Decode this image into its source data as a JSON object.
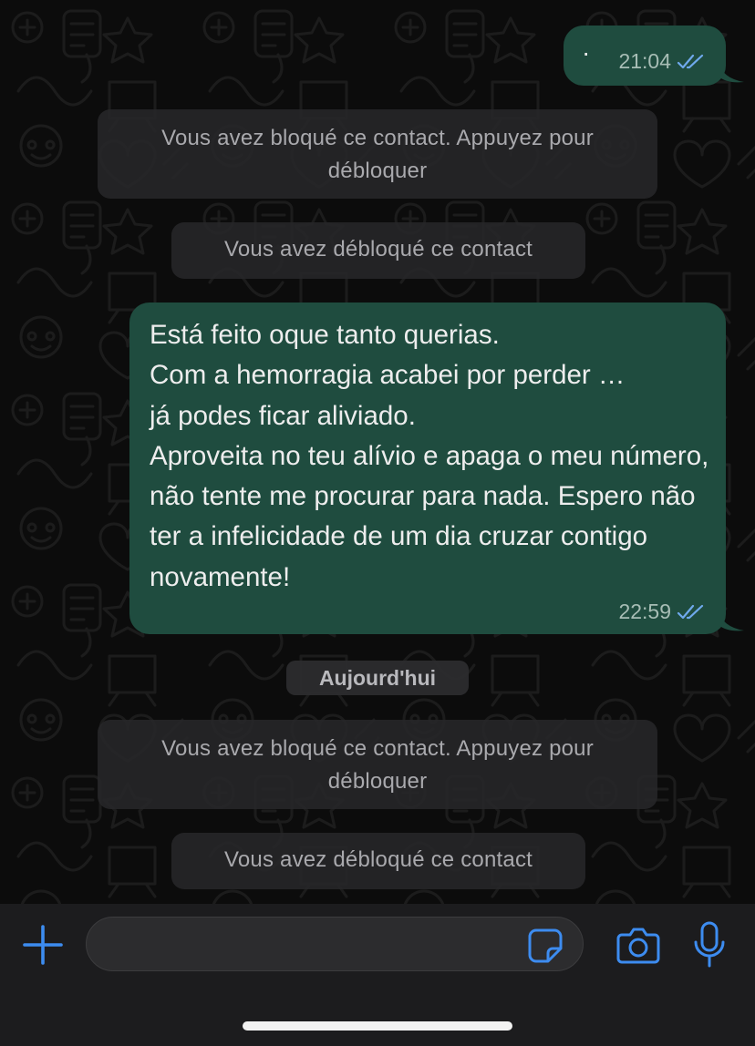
{
  "colors": {
    "outgoing_bubble": "#1f4c3f",
    "system_bubble": "#262628",
    "accent_blue": "#3d8cf0",
    "read_ticks": "#6fa9ec",
    "background": "#0c0c0c"
  },
  "messages": [
    {
      "type": "outgoing",
      "text": "·",
      "time": "21:04",
      "status_icon": "double-check-read-icon"
    },
    {
      "type": "system",
      "text": "Vous avez bloqué ce contact. Appuyez pour débloquer"
    },
    {
      "type": "system",
      "text": "Vous avez débloqué ce contact"
    },
    {
      "type": "outgoing",
      "text": "Está feito oque tanto querias.\nCom a hemorragia acabei por perder …\njá podes ficar aliviado.\nAproveita no teu alívio e apaga o meu número, não tente me procurar para nada. Espero não ter a infelicidade de um dia cruzar contigo novamente!",
      "time": "22:59",
      "status_icon": "double-check-read-icon"
    },
    {
      "type": "date",
      "text": "Aujourd'hui"
    },
    {
      "type": "system",
      "text": "Vous avez bloqué ce contact. Appuyez pour débloquer"
    },
    {
      "type": "system",
      "text": "Vous avez débloqué ce contact"
    }
  ],
  "composer": {
    "value": "",
    "icons": [
      "plus-icon",
      "sticker-icon",
      "camera-icon",
      "microphone-icon"
    ]
  }
}
